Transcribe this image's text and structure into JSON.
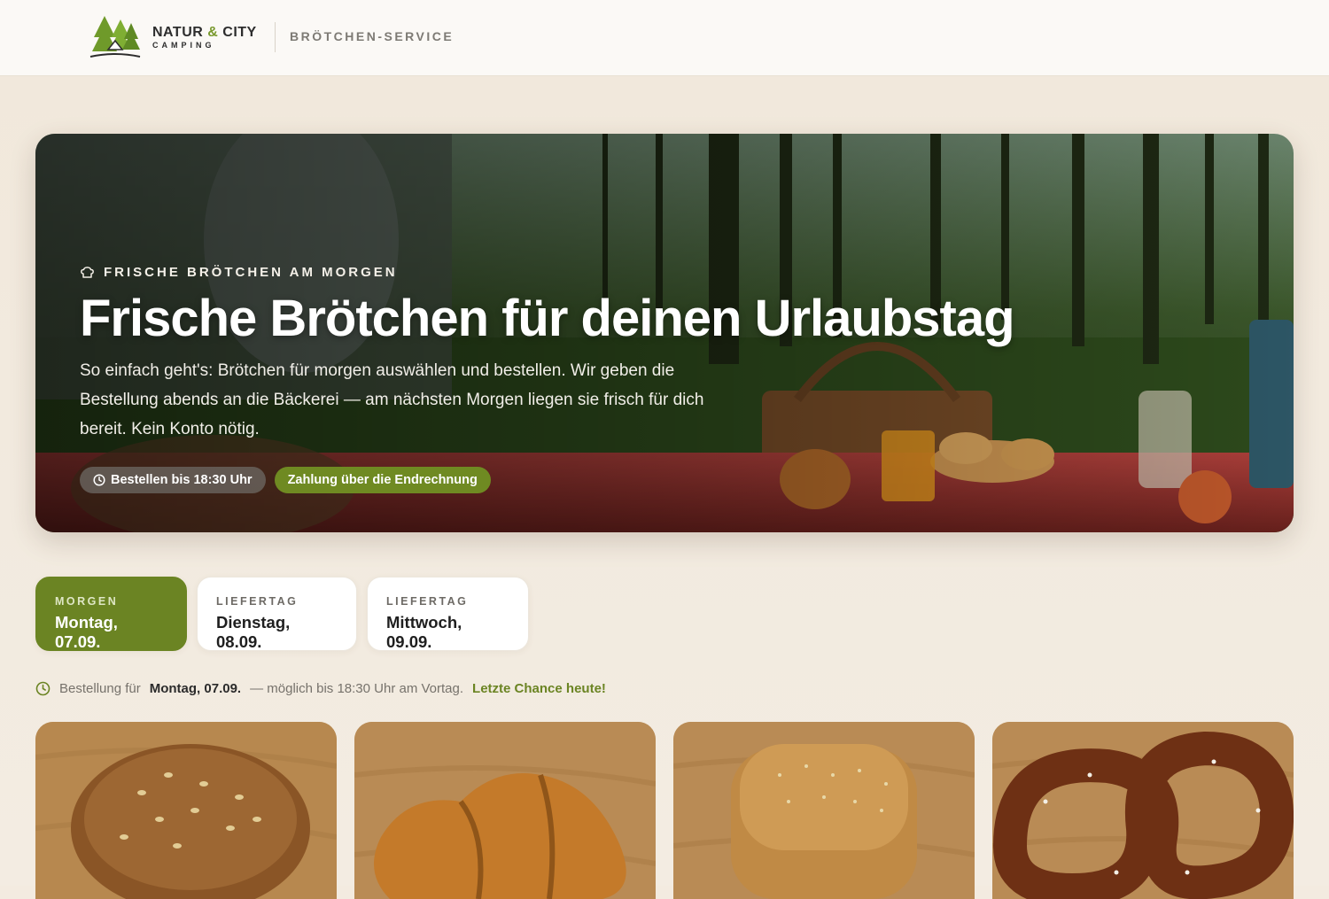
{
  "header": {
    "brand_name_part1": "NATUR",
    "brand_amp": "&",
    "brand_name_part2": "CITY",
    "brand_sub": "CAMPING",
    "service": "BRÖTCHEN-SERVICE"
  },
  "hero": {
    "kicker": "FRISCHE BRÖTCHEN AM MORGEN",
    "title": "Frische Brötchen für deinen Urlaubstag",
    "text": "So einfach geht's: Brötchen für morgen auswählen und bestellen. Wir geben die Bestellung abends an die Bäckerei — am nächsten Morgen liegen sie frisch für dich bereit. Kein Konto nötig.",
    "pill_deadline": "Bestellen bis 18:30 Uhr",
    "pill_payment": "Zahlung über die Endrechnung"
  },
  "days": [
    {
      "kicker": "MORGEN",
      "date": "Montag, 07.09."
    },
    {
      "kicker": "LIEFERTAG",
      "date": "Dienstag, 08.09."
    },
    {
      "kicker": "LIEFERTAG",
      "date": "Mittwoch, 09.09."
    }
  ],
  "deadline": {
    "prefix": "Bestellung für",
    "date": "Montag, 07.09.",
    "suffix": "— möglich bis 18:30 Uhr am Vortag.",
    "chance": "Letzte Chance heute!"
  },
  "products": [
    {
      "icon": "seed-roll-image"
    },
    {
      "icon": "croissant-image"
    },
    {
      "icon": "wholegrain-roll-image"
    },
    {
      "icon": "pretzel-image"
    }
  ],
  "colors": {
    "accent": "#6b8423",
    "background": "#f3ebe0"
  }
}
